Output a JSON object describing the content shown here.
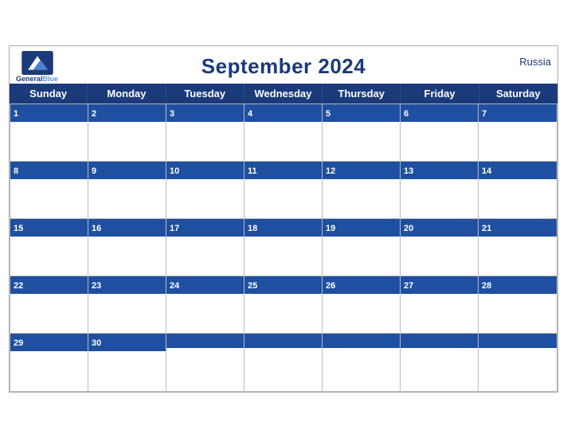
{
  "calendar": {
    "title": "September 2024",
    "country": "Russia",
    "brand": {
      "name_general": "General",
      "name_blue": "Blue"
    },
    "days": [
      "Sunday",
      "Monday",
      "Tuesday",
      "Wednesday",
      "Thursday",
      "Friday",
      "Saturday"
    ],
    "weeks": [
      [
        {
          "num": "1",
          "active": true
        },
        {
          "num": "2",
          "active": true
        },
        {
          "num": "3",
          "active": true
        },
        {
          "num": "4",
          "active": true
        },
        {
          "num": "5",
          "active": true
        },
        {
          "num": "6",
          "active": true
        },
        {
          "num": "7",
          "active": true
        }
      ],
      [
        {
          "num": "8",
          "active": true
        },
        {
          "num": "9",
          "active": true
        },
        {
          "num": "10",
          "active": true
        },
        {
          "num": "11",
          "active": true
        },
        {
          "num": "12",
          "active": true
        },
        {
          "num": "13",
          "active": true
        },
        {
          "num": "14",
          "active": true
        }
      ],
      [
        {
          "num": "15",
          "active": true
        },
        {
          "num": "16",
          "active": true
        },
        {
          "num": "17",
          "active": true
        },
        {
          "num": "18",
          "active": true
        },
        {
          "num": "19",
          "active": true
        },
        {
          "num": "20",
          "active": true
        },
        {
          "num": "21",
          "active": true
        }
      ],
      [
        {
          "num": "22",
          "active": true
        },
        {
          "num": "23",
          "active": true
        },
        {
          "num": "24",
          "active": true
        },
        {
          "num": "25",
          "active": true
        },
        {
          "num": "26",
          "active": true
        },
        {
          "num": "27",
          "active": true
        },
        {
          "num": "28",
          "active": true
        }
      ],
      [
        {
          "num": "29",
          "active": true
        },
        {
          "num": "30",
          "active": true
        },
        {
          "num": "",
          "active": false
        },
        {
          "num": "",
          "active": false
        },
        {
          "num": "",
          "active": false
        },
        {
          "num": "",
          "active": false
        },
        {
          "num": "",
          "active": false
        }
      ]
    ]
  }
}
